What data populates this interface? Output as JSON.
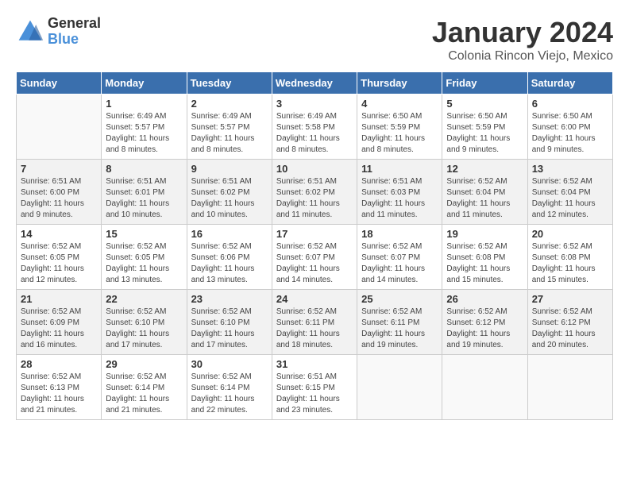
{
  "header": {
    "logo": {
      "general": "General",
      "blue": "Blue"
    },
    "title": "January 2024",
    "location": "Colonia Rincon Viejo, Mexico"
  },
  "weekdays": [
    "Sunday",
    "Monday",
    "Tuesday",
    "Wednesday",
    "Thursday",
    "Friday",
    "Saturday"
  ],
  "weeks": [
    [
      {
        "day": "",
        "info": ""
      },
      {
        "day": "1",
        "info": "Sunrise: 6:49 AM\nSunset: 5:57 PM\nDaylight: 11 hours\nand 8 minutes."
      },
      {
        "day": "2",
        "info": "Sunrise: 6:49 AM\nSunset: 5:57 PM\nDaylight: 11 hours\nand 8 minutes."
      },
      {
        "day": "3",
        "info": "Sunrise: 6:49 AM\nSunset: 5:58 PM\nDaylight: 11 hours\nand 8 minutes."
      },
      {
        "day": "4",
        "info": "Sunrise: 6:50 AM\nSunset: 5:59 PM\nDaylight: 11 hours\nand 8 minutes."
      },
      {
        "day": "5",
        "info": "Sunrise: 6:50 AM\nSunset: 5:59 PM\nDaylight: 11 hours\nand 9 minutes."
      },
      {
        "day": "6",
        "info": "Sunrise: 6:50 AM\nSunset: 6:00 PM\nDaylight: 11 hours\nand 9 minutes."
      }
    ],
    [
      {
        "day": "7",
        "info": "Sunrise: 6:51 AM\nSunset: 6:00 PM\nDaylight: 11 hours\nand 9 minutes."
      },
      {
        "day": "8",
        "info": "Sunrise: 6:51 AM\nSunset: 6:01 PM\nDaylight: 11 hours\nand 10 minutes."
      },
      {
        "day": "9",
        "info": "Sunrise: 6:51 AM\nSunset: 6:02 PM\nDaylight: 11 hours\nand 10 minutes."
      },
      {
        "day": "10",
        "info": "Sunrise: 6:51 AM\nSunset: 6:02 PM\nDaylight: 11 hours\nand 11 minutes."
      },
      {
        "day": "11",
        "info": "Sunrise: 6:51 AM\nSunset: 6:03 PM\nDaylight: 11 hours\nand 11 minutes."
      },
      {
        "day": "12",
        "info": "Sunrise: 6:52 AM\nSunset: 6:04 PM\nDaylight: 11 hours\nand 11 minutes."
      },
      {
        "day": "13",
        "info": "Sunrise: 6:52 AM\nSunset: 6:04 PM\nDaylight: 11 hours\nand 12 minutes."
      }
    ],
    [
      {
        "day": "14",
        "info": "Sunrise: 6:52 AM\nSunset: 6:05 PM\nDaylight: 11 hours\nand 12 minutes."
      },
      {
        "day": "15",
        "info": "Sunrise: 6:52 AM\nSunset: 6:05 PM\nDaylight: 11 hours\nand 13 minutes."
      },
      {
        "day": "16",
        "info": "Sunrise: 6:52 AM\nSunset: 6:06 PM\nDaylight: 11 hours\nand 13 minutes."
      },
      {
        "day": "17",
        "info": "Sunrise: 6:52 AM\nSunset: 6:07 PM\nDaylight: 11 hours\nand 14 minutes."
      },
      {
        "day": "18",
        "info": "Sunrise: 6:52 AM\nSunset: 6:07 PM\nDaylight: 11 hours\nand 14 minutes."
      },
      {
        "day": "19",
        "info": "Sunrise: 6:52 AM\nSunset: 6:08 PM\nDaylight: 11 hours\nand 15 minutes."
      },
      {
        "day": "20",
        "info": "Sunrise: 6:52 AM\nSunset: 6:08 PM\nDaylight: 11 hours\nand 15 minutes."
      }
    ],
    [
      {
        "day": "21",
        "info": "Sunrise: 6:52 AM\nSunset: 6:09 PM\nDaylight: 11 hours\nand 16 minutes."
      },
      {
        "day": "22",
        "info": "Sunrise: 6:52 AM\nSunset: 6:10 PM\nDaylight: 11 hours\nand 17 minutes."
      },
      {
        "day": "23",
        "info": "Sunrise: 6:52 AM\nSunset: 6:10 PM\nDaylight: 11 hours\nand 17 minutes."
      },
      {
        "day": "24",
        "info": "Sunrise: 6:52 AM\nSunset: 6:11 PM\nDaylight: 11 hours\nand 18 minutes."
      },
      {
        "day": "25",
        "info": "Sunrise: 6:52 AM\nSunset: 6:11 PM\nDaylight: 11 hours\nand 19 minutes."
      },
      {
        "day": "26",
        "info": "Sunrise: 6:52 AM\nSunset: 6:12 PM\nDaylight: 11 hours\nand 19 minutes."
      },
      {
        "day": "27",
        "info": "Sunrise: 6:52 AM\nSunset: 6:12 PM\nDaylight: 11 hours\nand 20 minutes."
      }
    ],
    [
      {
        "day": "28",
        "info": "Sunrise: 6:52 AM\nSunset: 6:13 PM\nDaylight: 11 hours\nand 21 minutes."
      },
      {
        "day": "29",
        "info": "Sunrise: 6:52 AM\nSunset: 6:14 PM\nDaylight: 11 hours\nand 21 minutes."
      },
      {
        "day": "30",
        "info": "Sunrise: 6:52 AM\nSunset: 6:14 PM\nDaylight: 11 hours\nand 22 minutes."
      },
      {
        "day": "31",
        "info": "Sunrise: 6:51 AM\nSunset: 6:15 PM\nDaylight: 11 hours\nand 23 minutes."
      },
      {
        "day": "",
        "info": ""
      },
      {
        "day": "",
        "info": ""
      },
      {
        "day": "",
        "info": ""
      }
    ]
  ]
}
